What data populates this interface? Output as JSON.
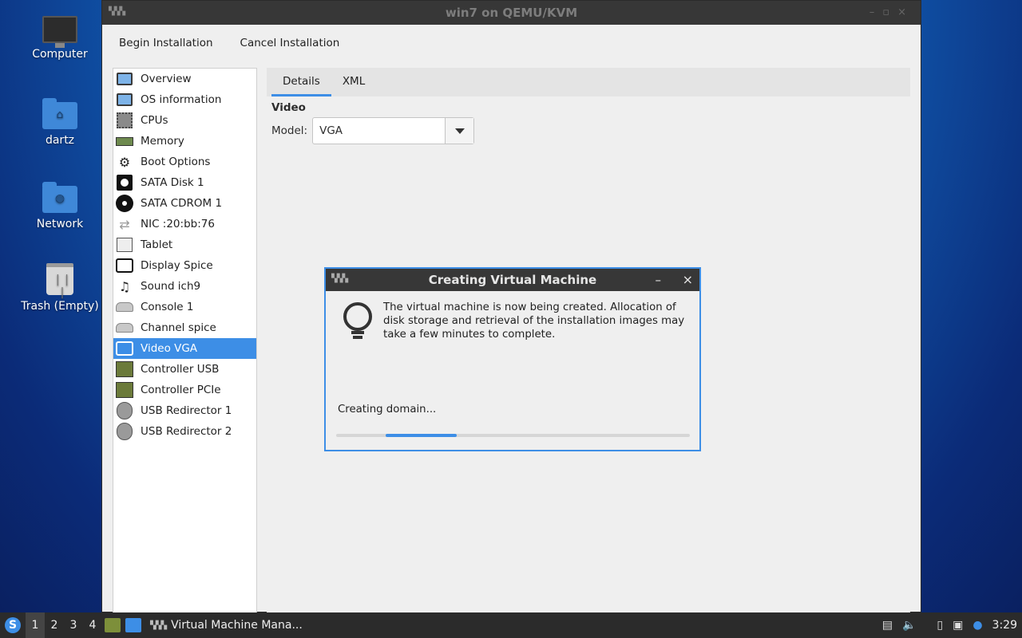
{
  "desktop": {
    "icons": [
      {
        "label": "Computer",
        "icon": "computer-icon"
      },
      {
        "label": "dartz",
        "icon": "home-folder-icon"
      },
      {
        "label": "Network",
        "icon": "network-folder-icon"
      },
      {
        "label": "Trash (Empty)",
        "icon": "trash-icon"
      }
    ]
  },
  "window": {
    "title": "win7 on QEMU/KVM",
    "toolbar": {
      "begin_label": "Begin Installation",
      "cancel_label": "Cancel Installation"
    },
    "sidebar": {
      "items": [
        {
          "label": "Overview",
          "icon": "monitor-icon"
        },
        {
          "label": "OS information",
          "icon": "monitor-icon"
        },
        {
          "label": "CPUs",
          "icon": "cpu-icon"
        },
        {
          "label": "Memory",
          "icon": "memory-icon"
        },
        {
          "label": "Boot Options",
          "icon": "gear-icon"
        },
        {
          "label": "SATA Disk 1",
          "icon": "disk-icon"
        },
        {
          "label": "SATA CDROM 1",
          "icon": "cdrom-icon"
        },
        {
          "label": "NIC :20:bb:76",
          "icon": "network-arrows-icon"
        },
        {
          "label": "Tablet",
          "icon": "tablet-icon"
        },
        {
          "label": "Display Spice",
          "icon": "display-icon"
        },
        {
          "label": "Sound ich9",
          "icon": "sound-icon"
        },
        {
          "label": "Console 1",
          "icon": "console-icon"
        },
        {
          "label": "Channel spice",
          "icon": "channel-icon"
        },
        {
          "label": "Video VGA",
          "icon": "display-icon",
          "selected": true
        },
        {
          "label": "Controller USB",
          "icon": "controller-icon"
        },
        {
          "label": "Controller PCIe",
          "icon": "controller-icon"
        },
        {
          "label": "USB Redirector 1",
          "icon": "usb-icon"
        },
        {
          "label": "USB Redirector 2",
          "icon": "usb-icon"
        }
      ]
    },
    "tabs": [
      {
        "label": "Details",
        "active": true
      },
      {
        "label": "XML",
        "active": false
      }
    ],
    "details": {
      "section_title": "Video",
      "model_label": "Model:",
      "model_value": "VGA"
    }
  },
  "dialog": {
    "title": "Creating Virtual Machine",
    "message": "The virtual machine is now being created. Allocation of disk storage and retrieval of the installation images may take a few minutes to complete.",
    "status": "Creating domain...",
    "progress_fraction": 0.2
  },
  "taskbar": {
    "workspaces": [
      "1",
      "2",
      "3",
      "4"
    ],
    "active_workspace": "1",
    "task_label": "Virtual Machine Mana...",
    "clock": "3:29"
  },
  "colors": {
    "accent": "#3d8ee6",
    "titlebar": "#373737"
  }
}
